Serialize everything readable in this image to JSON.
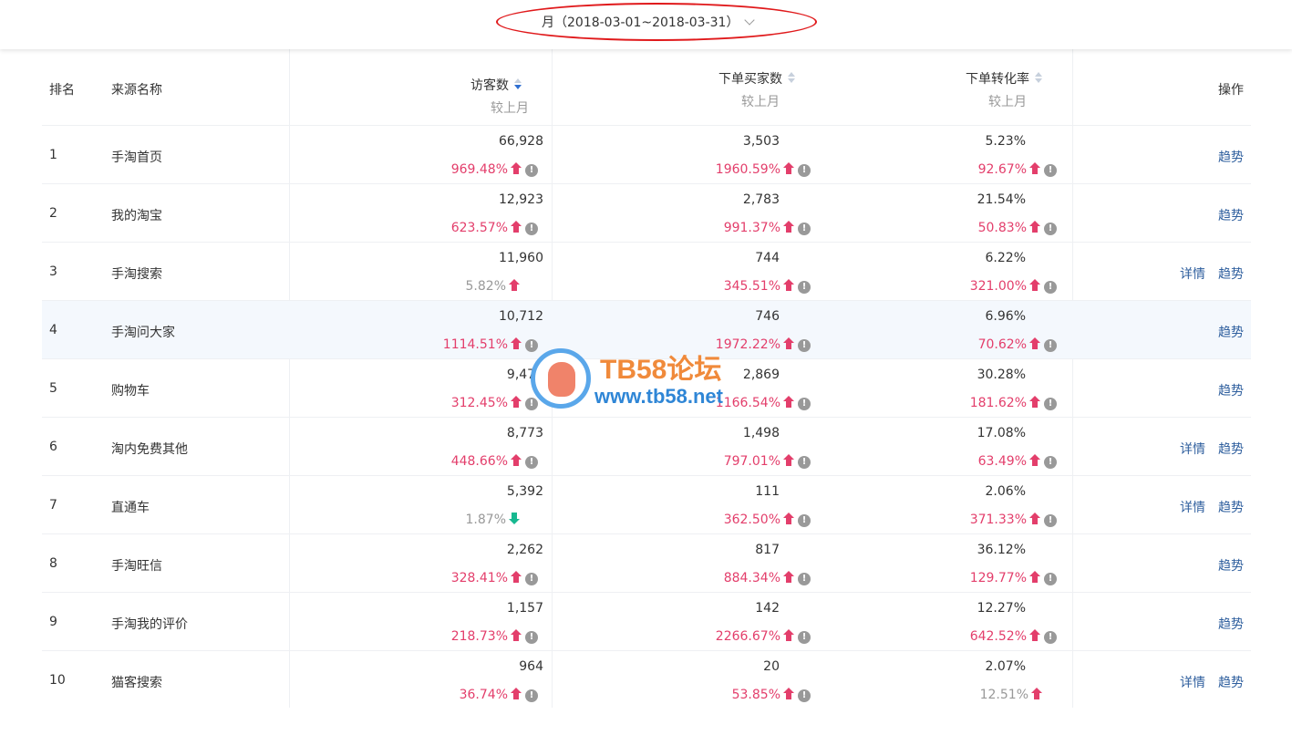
{
  "period": {
    "label": "月（2018-03-01~2018-03-31）"
  },
  "columns": {
    "rank": "排名",
    "source": "来源名称",
    "visitors": "访客数",
    "buyers": "下单买家数",
    "conversion": "下单转化率",
    "compare": "较上月",
    "ops": "操作"
  },
  "actions": {
    "detail": "详情",
    "trend": "趋势"
  },
  "rows": [
    {
      "rank": "1",
      "name": "手淘首页",
      "visitors": "66,928",
      "visitors_chg": "969.48%",
      "buyers": "3,503",
      "buyers_chg": "1960.59%",
      "conv": "5.23%",
      "conv_chg": "92.67%"
    },
    {
      "rank": "2",
      "name": "我的淘宝",
      "visitors": "12,923",
      "visitors_chg": "623.57%",
      "buyers": "2,783",
      "buyers_chg": "991.37%",
      "conv": "21.54%",
      "conv_chg": "50.83%"
    },
    {
      "rank": "3",
      "name": "手淘搜索",
      "visitors": "11,960",
      "visitors_chg": "5.82%",
      "buyers": "744",
      "buyers_chg": "345.51%",
      "conv": "6.22%",
      "conv_chg": "321.00%"
    },
    {
      "rank": "4",
      "name": "手淘问大家",
      "visitors": "10,712",
      "visitors_chg": "1114.51%",
      "buyers": "746",
      "buyers_chg": "1972.22%",
      "conv": "6.96%",
      "conv_chg": "70.62%"
    },
    {
      "rank": "5",
      "name": "购物车",
      "visitors": "9,474",
      "visitors_chg": "312.45%",
      "buyers": "2,869",
      "buyers_chg": "1166.54%",
      "conv": "30.28%",
      "conv_chg": "181.62%"
    },
    {
      "rank": "6",
      "name": "淘内免费其他",
      "visitors": "8,773",
      "visitors_chg": "448.66%",
      "buyers": "1,498",
      "buyers_chg": "797.01%",
      "conv": "17.08%",
      "conv_chg": "63.49%"
    },
    {
      "rank": "7",
      "name": "直通车",
      "visitors": "5,392",
      "visitors_chg": "1.87%",
      "buyers": "111",
      "buyers_chg": "362.50%",
      "conv": "2.06%",
      "conv_chg": "371.33%"
    },
    {
      "rank": "8",
      "name": "手淘旺信",
      "visitors": "2,262",
      "visitors_chg": "328.41%",
      "buyers": "817",
      "buyers_chg": "884.34%",
      "conv": "36.12%",
      "conv_chg": "129.77%"
    },
    {
      "rank": "9",
      "name": "手淘我的评价",
      "visitors": "1,157",
      "visitors_chg": "218.73%",
      "buyers": "142",
      "buyers_chg": "2266.67%",
      "conv": "12.27%",
      "conv_chg": "642.52%"
    },
    {
      "rank": "10",
      "name": "猫客搜索",
      "visitors": "964",
      "visitors_chg": "36.74%",
      "buyers": "20",
      "buyers_chg": "53.85%",
      "conv": "2.07%",
      "conv_chg": "12.51%"
    }
  ],
  "watermark": {
    "title": "TB58论坛",
    "url": "www.tb58.net"
  },
  "colors": {
    "up": "#e33e6b",
    "down": "#17b890",
    "link": "#2f5f9e",
    "highlight": "#e0191b"
  }
}
